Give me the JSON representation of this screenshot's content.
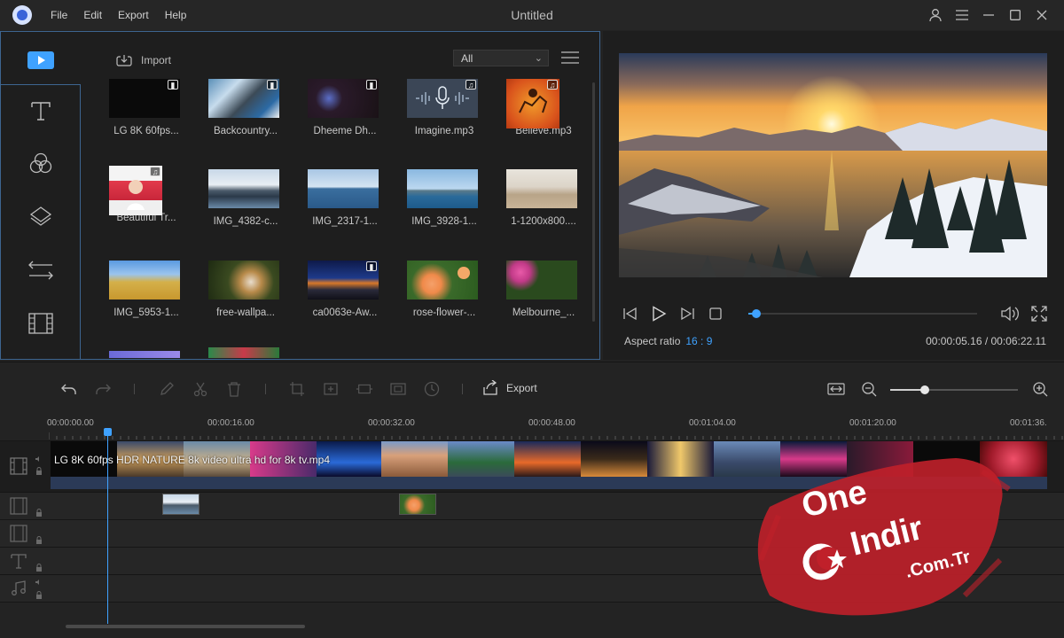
{
  "app": {
    "title": "Untitled",
    "menu": [
      "File",
      "Edit",
      "Export",
      "Help"
    ]
  },
  "media_panel": {
    "import_label": "Import",
    "filter_value": "All",
    "rail": [
      "media-icon",
      "text-icon",
      "filter-icon",
      "overlay-icon",
      "transition-icon",
      "film-icon"
    ],
    "items": [
      {
        "name": "LG 8K 60fps...",
        "type": "video"
      },
      {
        "name": "Backcountry...",
        "type": "video"
      },
      {
        "name": "Dheeme Dh...",
        "type": "video"
      },
      {
        "name": "Imagine.mp3",
        "type": "audio"
      },
      {
        "name": "Believe.mp3",
        "type": "audio"
      },
      {
        "name": "Beautiful Tr...",
        "type": "audio"
      },
      {
        "name": "IMG_4382-c...",
        "type": "image"
      },
      {
        "name": "IMG_2317-1...",
        "type": "image"
      },
      {
        "name": "IMG_3928-1...",
        "type": "image"
      },
      {
        "name": "1-1200x800....",
        "type": "image"
      },
      {
        "name": "IMG_5953-1...",
        "type": "image"
      },
      {
        "name": "free-wallpa...",
        "type": "image"
      },
      {
        "name": "ca0063e-Aw...",
        "type": "video"
      },
      {
        "name": "rose-flower-...",
        "type": "image"
      },
      {
        "name": "Melbourne_...",
        "type": "image"
      }
    ]
  },
  "preview": {
    "aspect_label": "Aspect ratio",
    "aspect_value": "16 : 9",
    "timecode": "00:00:05.16 / 00:06:22.11",
    "progress": 0.035
  },
  "toolbar": {
    "export_label": "Export",
    "zoom_level": 0.27
  },
  "timeline": {
    "ruler_labels": [
      "00:00:00.00",
      "00:00:16.00",
      "00:00:32.00",
      "00:00:48.00",
      "00:01:04.00",
      "00:01:20.00",
      "00:01:36."
    ],
    "main_clip_label": "LG 8K 60fps HDR NATURE 8k video ultra hd for 8k tv.mp4",
    "tracks": [
      "video-track",
      "pip-track-1",
      "pip-track-2",
      "text-track",
      "music-track"
    ]
  },
  "watermark": {
    "line1": "One",
    "line2": "Indir",
    "line3": ".Com.Tr"
  },
  "colors": {
    "accent": "#3fa2ff",
    "panel_border": "#3d6590",
    "background": "#232323"
  }
}
